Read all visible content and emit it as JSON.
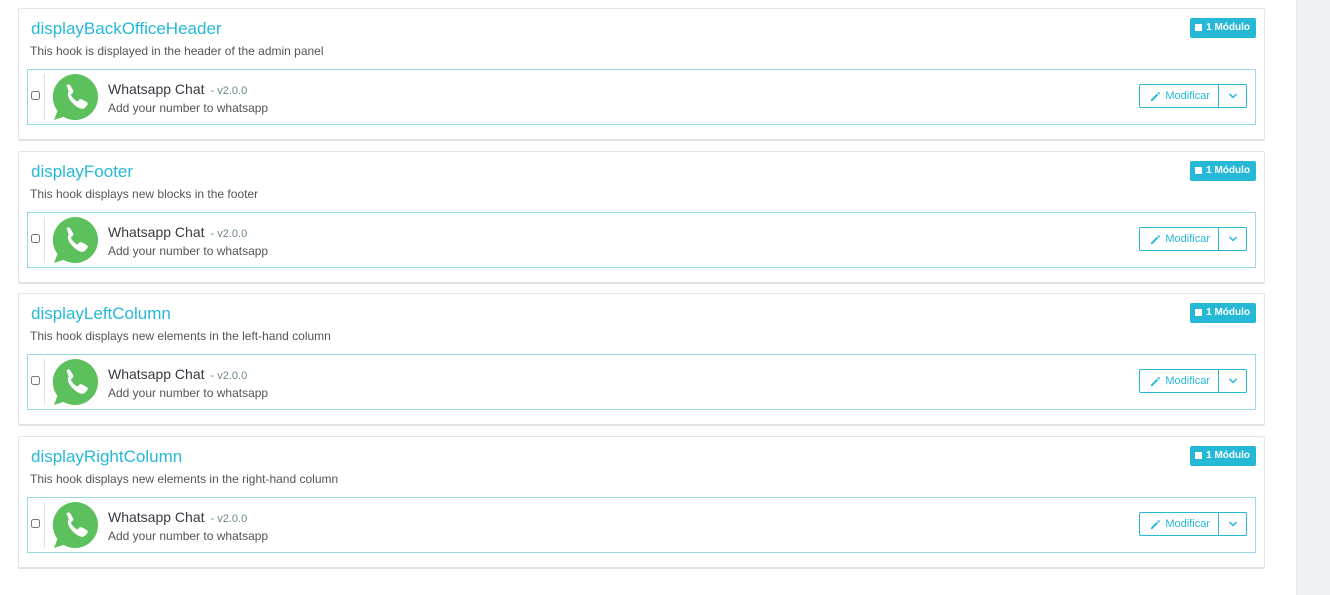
{
  "colors": {
    "accent": "#25b9d7",
    "whatsapp": "#5cc15c"
  },
  "hooks": [
    {
      "title": "displayBackOfficeHeader",
      "description": "This hook is displayed in the header of the admin panel",
      "badge": "1 Módulo",
      "module": {
        "icon": "whatsapp-logo-icon",
        "name": "Whatsapp Chat",
        "version": "- v2.0.0",
        "description": "Add your number to whatsapp",
        "edit_label": "Modificar"
      }
    },
    {
      "title": "displayFooter",
      "description": "This hook displays new blocks in the footer",
      "badge": "1 Módulo",
      "module": {
        "icon": "whatsapp-logo-icon",
        "name": "Whatsapp Chat",
        "version": "- v2.0.0",
        "description": "Add your number to whatsapp",
        "edit_label": "Modificar"
      }
    },
    {
      "title": "displayLeftColumn",
      "description": "This hook displays new elements in the left-hand column",
      "badge": "1 Módulo",
      "module": {
        "icon": "whatsapp-logo-icon",
        "name": "Whatsapp Chat",
        "version": "- v2.0.0",
        "description": "Add your number to whatsapp",
        "edit_label": "Modificar"
      }
    },
    {
      "title": "displayRightColumn",
      "description": "This hook displays new elements in the right-hand column",
      "badge": "1 Módulo",
      "module": {
        "icon": "whatsapp-logo-icon",
        "name": "Whatsapp Chat",
        "version": "- v2.0.0",
        "description": "Add your number to whatsapp",
        "edit_label": "Modificar"
      }
    }
  ]
}
